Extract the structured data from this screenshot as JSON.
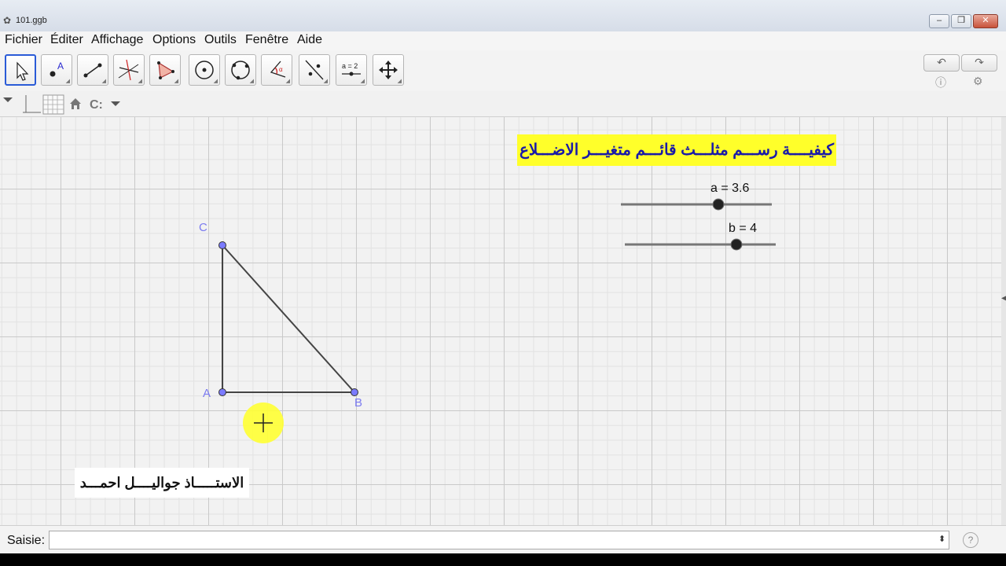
{
  "window": {
    "title": "101.ggb",
    "buttons": [
      "–",
      "❐",
      "✕"
    ]
  },
  "menu": [
    "Fichier",
    "Éditer",
    "Affichage",
    "Options",
    "Outils",
    "Fenêtre",
    "Aide"
  ],
  "toolbar": {
    "tools": [
      "move-tool",
      "point-tool",
      "segment-tool",
      "perpendicular-line-tool",
      "polygon-tool",
      "circle-center-point-tool",
      "circle-three-points-tool",
      "angle-tool",
      "reflect-line-tool",
      "slider-tool",
      "move-view-tool"
    ],
    "active_tool": "move-tool",
    "slider_tool_label": "a = 2",
    "undo_icon": "undo-icon",
    "redo_icon": "redo-icon"
  },
  "stylebar": {
    "icons": [
      "toggle-stylebar-icon",
      "axes-icon",
      "grid-icon",
      "home-icon",
      "point-capture-icon"
    ]
  },
  "canvas": {
    "banner": "كيفيــــة رســـم مثلـــث قائـــم متغيـــر الاضـــلاع",
    "credit": "الاستـــــاذ جواليــــل احمـــد",
    "sliders": [
      {
        "label": "a = 3.6",
        "value": 3.6
      },
      {
        "label": "b = 4",
        "value": 4
      }
    ],
    "points": [
      {
        "name": "A"
      },
      {
        "name": "B"
      },
      {
        "name": "C"
      }
    ],
    "colors": {
      "point_fill": "#7b7bff",
      "point_label": "#7a7af0",
      "segment": "#444444",
      "banner_bg": "#ffff2a",
      "banner_text": "#1a1aa8",
      "cursor_highlight": "#ffff33"
    }
  },
  "input_bar": {
    "label": "Saisie:",
    "value": ""
  }
}
